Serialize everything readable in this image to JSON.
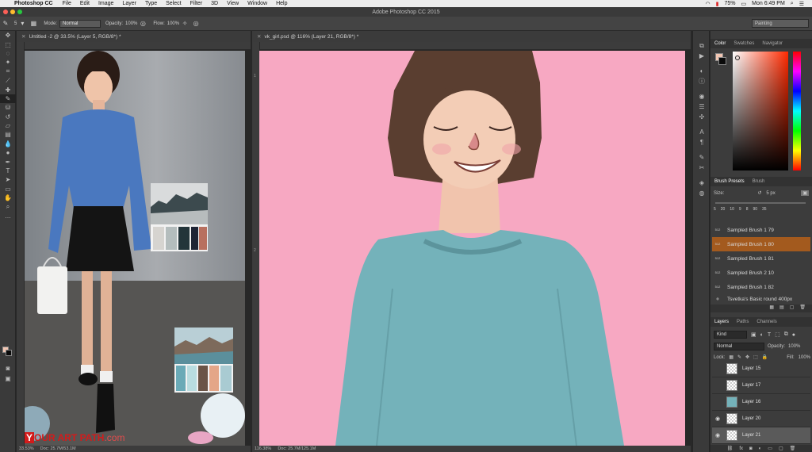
{
  "menubar": {
    "app_name": "Photoshop CC",
    "items": [
      "File",
      "Edit",
      "Image",
      "Layer",
      "Type",
      "Select",
      "Filter",
      "3D",
      "View",
      "Window",
      "Help"
    ],
    "battery": "75%",
    "clock": "Mon 6:49 PM"
  },
  "window": {
    "title": "Adobe Photoshop CC 2015"
  },
  "options": {
    "brush_size": "5",
    "mode_label": "Mode:",
    "mode_value": "Normal",
    "opacity_label": "Opacity:",
    "opacity_value": "100%",
    "flow_label": "Flow:",
    "flow_value": "100%",
    "workspace": "Painting"
  },
  "doc_left": {
    "tab": "Untitled -2 @ 33.5% (Layer 5, RGB/8*) *",
    "zoom": "33.53%",
    "doc_size": "Doc: 25.7M/53.1M"
  },
  "doc_right": {
    "tab": "vk_girl.psd @ 116% (Layer 21, RGB/8*) *",
    "zoom": "116.38%",
    "doc_size": "Doc: 25.7M/125.1M",
    "ruler_marks": [
      "1",
      "2"
    ]
  },
  "watermark": {
    "part1": "Y",
    "part2": "OUR ART PATH",
    "part3": ".com"
  },
  "color_panel": {
    "tabs": [
      "Color",
      "Swatches",
      "Navigator"
    ]
  },
  "brush_panel": {
    "tabs": [
      "Brush Presets",
      "Brush"
    ],
    "size_label": "Size:",
    "size_value": "5 px",
    "preset_sizes": [
      "5",
      "20",
      "10",
      "9",
      "8",
      "90",
      "35"
    ],
    "items": [
      {
        "num": "512",
        "name": "Sampled Brush 1 79",
        "active": false
      },
      {
        "num": "512",
        "name": "Sampled Brush 1 80",
        "active": true
      },
      {
        "num": "512",
        "name": "Sampled Brush 1 81",
        "active": false
      },
      {
        "num": "512",
        "name": "Sampled Brush 2 10",
        "active": false
      },
      {
        "num": "512",
        "name": "Sampled Brush 1 82",
        "active": false
      },
      {
        "num": "",
        "name": "Tsvetka's Basic round 400px",
        "active": false
      }
    ]
  },
  "layers_panel": {
    "tabs": [
      "Layers",
      "Paths",
      "Channels"
    ],
    "kind": "Kind",
    "blend": "Normal",
    "opacity_label": "Opacity:",
    "opacity_value": "100%",
    "lock_label": "Lock:",
    "fill_label": "Fill:",
    "fill_value": "100%",
    "layers": [
      {
        "name": "Layer 15",
        "visible": false
      },
      {
        "name": "Layer 17",
        "visible": false
      },
      {
        "name": "Layer 16",
        "visible": false
      },
      {
        "name": "Layer 20",
        "visible": true
      },
      {
        "name": "Layer 21",
        "visible": true
      }
    ]
  },
  "colors": {
    "canvas_pink": "#f7a8c2",
    "sweater_teal": "#74b2ba",
    "active_brush": "#a35a1e",
    "foreground": "#f2c6b3"
  }
}
